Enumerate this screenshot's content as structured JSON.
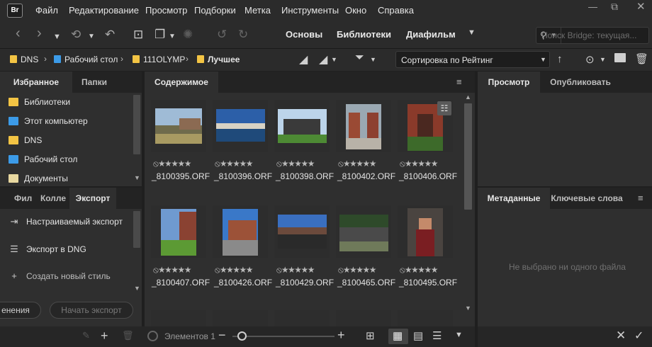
{
  "app": {
    "logo": "Br"
  },
  "menu": [
    "Файл",
    "Редактирование",
    "Просмотр",
    "Подборки",
    "Метка",
    "Инструменты",
    "Окно",
    "Справка"
  ],
  "workspaces": {
    "basics": "Основы",
    "libraries": "Библиотеки",
    "filmstrip": "Диафильм"
  },
  "search": {
    "placeholder": "Поиск Bridge: текущая..."
  },
  "breadcrumb": [
    "DNS",
    "Рабочий стол",
    "111OLYMP",
    "Лучшее"
  ],
  "sort": {
    "label": "Сортировка по Рейтинг"
  },
  "left_panel": {
    "tabs": {
      "favorites": "Избранное",
      "folders": "Папки"
    },
    "favorites": [
      "Библиотеки",
      "Этот компьютер",
      "DNS",
      "Рабочий стол",
      "Документы"
    ],
    "lower_tabs": {
      "filter": "Фил",
      "collections": "Колле",
      "export": "Экспорт"
    },
    "export_items": [
      "Настраиваемый экспорт",
      "Экспорт в DNG",
      "Создать новый стиль"
    ],
    "buttons": {
      "cancel_partial": "енения",
      "start_export": "Начать экспорт"
    }
  },
  "content": {
    "tab": "Содержимое",
    "items": [
      {
        "name": "_8100395.ORF",
        "rating": "⦸★★★★★"
      },
      {
        "name": "_8100396.ORF",
        "rating": "⦸★★★★★"
      },
      {
        "name": "_8100398.ORF",
        "rating": "⦸★★★★★"
      },
      {
        "name": "_8100402.ORF",
        "rating": "⦸★★★★★"
      },
      {
        "name": "_8100406.ORF",
        "rating": "⦸★★★★★"
      },
      {
        "name": "_8100407.ORF",
        "rating": "⦸★★★★★"
      },
      {
        "name": "_8100426.ORF",
        "rating": "⦸★★★★★"
      },
      {
        "name": "_8100429.ORF",
        "rating": "⦸★★★★★"
      },
      {
        "name": "_8100465.ORF",
        "rating": "⦸★★★★★"
      },
      {
        "name": "_8100495.ORF",
        "rating": "⦸★★★★★"
      }
    ],
    "status": "Элементов 1"
  },
  "right_panel": {
    "tabs": {
      "preview": "Просмотр",
      "publish": "Опубликовать"
    },
    "meta_tabs": {
      "metadata": "Метаданные",
      "keywords": "Ключевые слова"
    },
    "no_selection": "Не выбрано ни одного файла"
  },
  "colors": {
    "folder": "#f3c444",
    "background": "#1f1f1f",
    "panel": "#2b2b2b",
    "accent": "#e8e8e8"
  }
}
